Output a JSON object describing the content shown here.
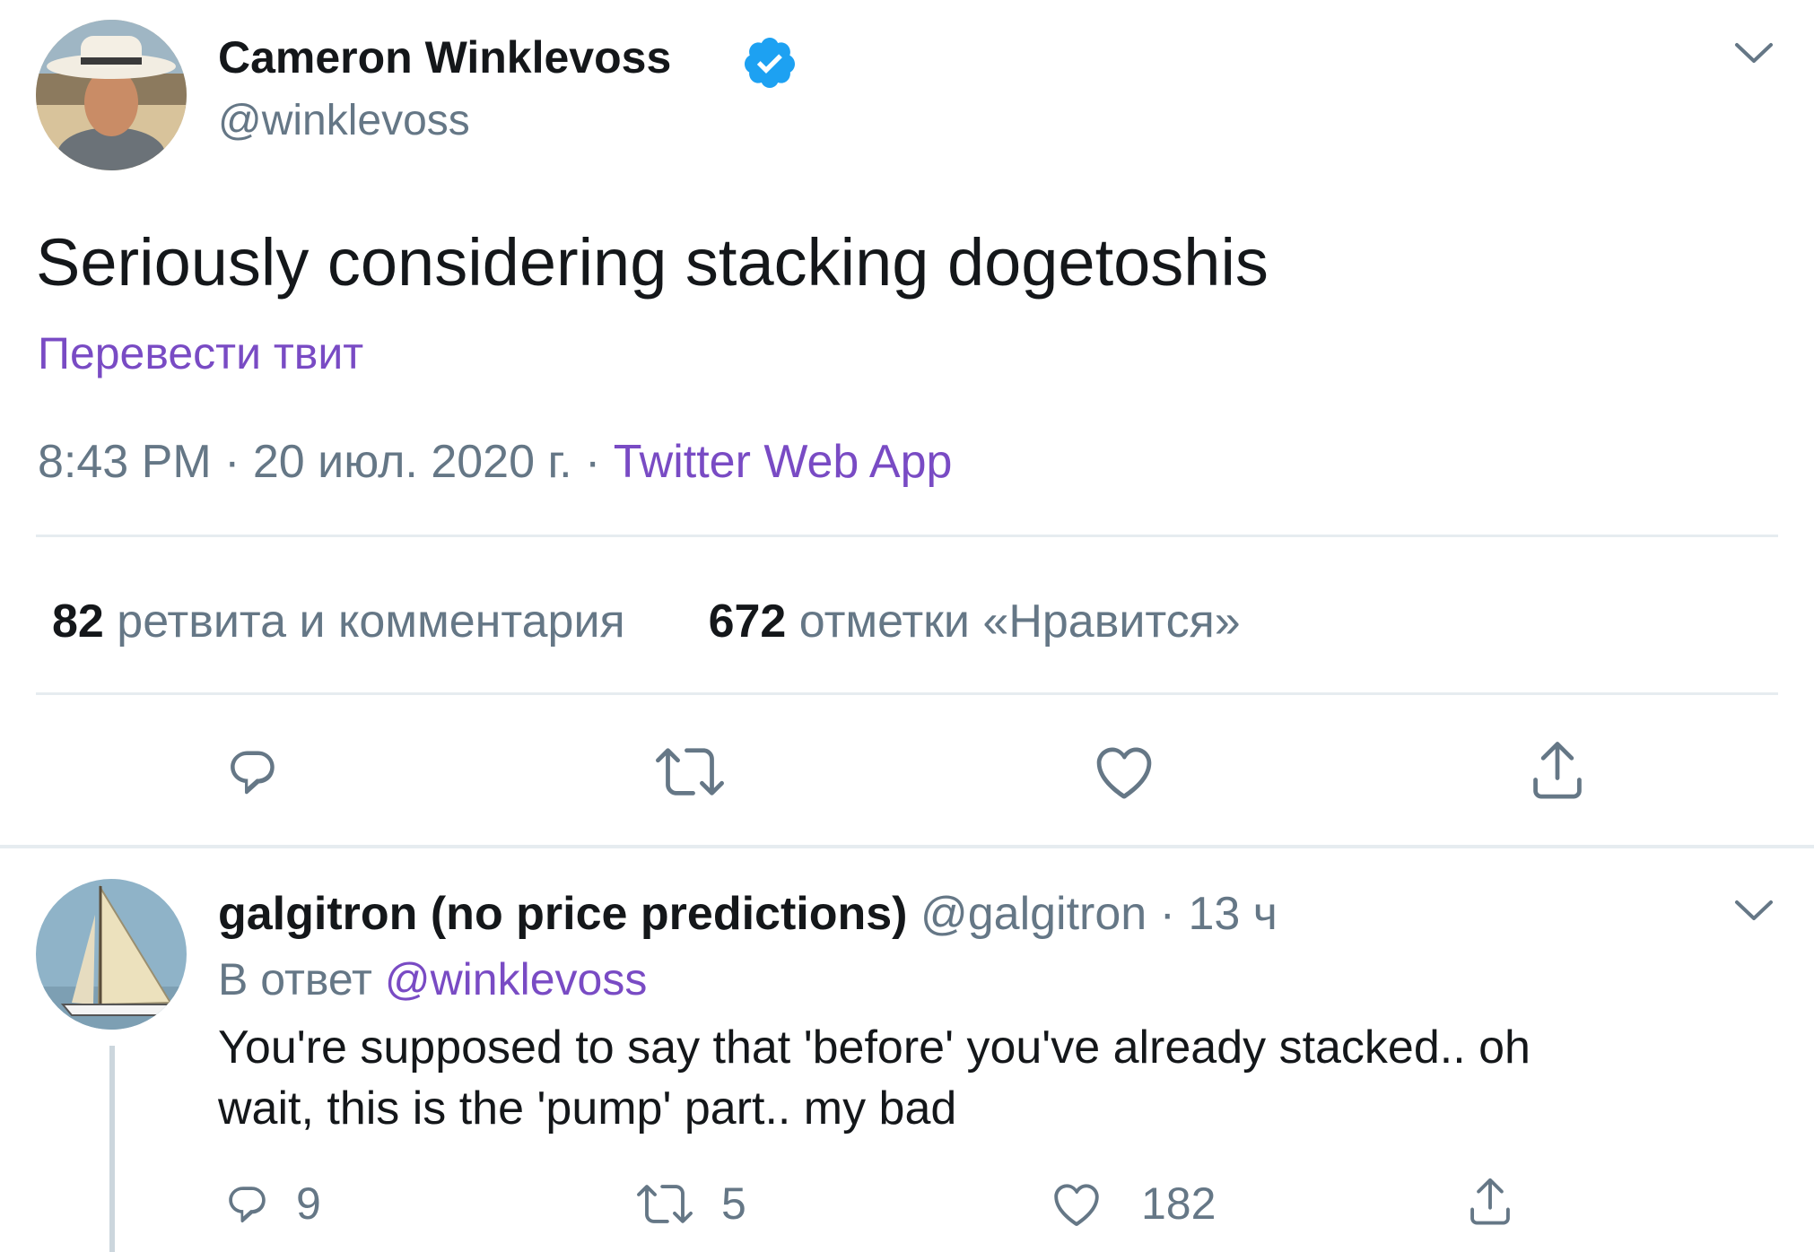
{
  "main_tweet": {
    "author_name": "Cameron Winklevoss",
    "author_handle": "@winklevoss",
    "verified": true,
    "text": "Seriously considering stacking dogetoshis",
    "translate_label": "Перевести твит",
    "time": "8:43 PM",
    "date": "20 июл. 2020 г.",
    "separator": "·",
    "source": "Twitter Web App",
    "retweets_count": "82",
    "retweets_label": "ретвита и комментария",
    "likes_count": "672",
    "likes_label": "отметки «Нравится»"
  },
  "reply": {
    "author_name": "galgitron (no price predictions)",
    "author_handle": "@galgitron",
    "separator": "·",
    "time": "13 ч",
    "in_reply_label": "В ответ",
    "in_reply_handle": "@winklevoss",
    "text_line1": "You're supposed to say that 'before' you've already stacked..  oh",
    "text_line2": "wait, this is the 'pump' part.. my bad",
    "reply_count": "9",
    "retweet_count": "5",
    "like_count": "182"
  },
  "icons": {
    "menu": "chevron-down-icon",
    "verified": "verified-badge-icon",
    "reply": "comment-icon",
    "retweet": "retweet-icon",
    "like": "heart-icon",
    "share": "share-icon"
  },
  "colors": {
    "accent": "#794bc4",
    "verified": "#1da1f2",
    "muted": "#657786",
    "divider": "#e6ecf0"
  }
}
